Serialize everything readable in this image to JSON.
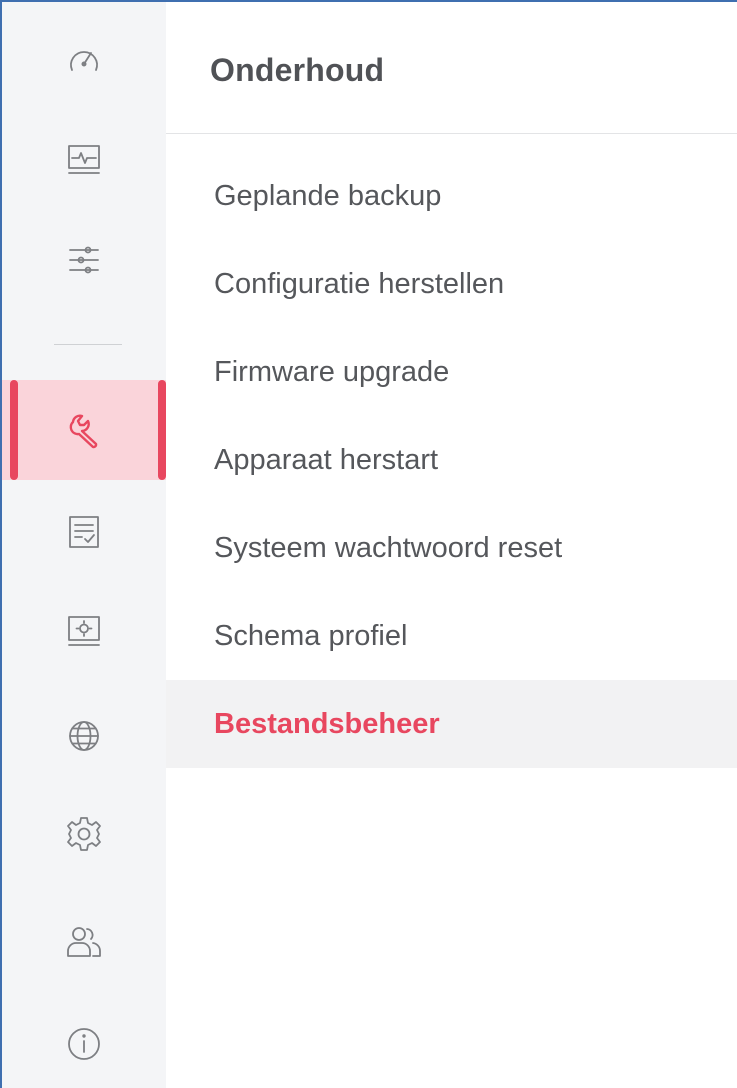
{
  "section": {
    "title": "Onderhoud"
  },
  "rail": {
    "items": [
      {
        "icon": "gauge-icon",
        "label": ""
      },
      {
        "icon": "activity-monitor-icon",
        "label": ""
      },
      {
        "icon": "sliders-icon",
        "label": ""
      },
      {
        "icon": "wrench-icon",
        "label": "",
        "active": true
      },
      {
        "icon": "checklist-icon",
        "label": ""
      },
      {
        "icon": "screen-settings-icon",
        "label": ""
      },
      {
        "icon": "globe-icon",
        "label": ""
      },
      {
        "icon": "gear-icon",
        "label": ""
      },
      {
        "icon": "users-icon",
        "label": ""
      },
      {
        "icon": "info-icon",
        "label": ""
      }
    ],
    "active_color": "#e8475f",
    "active_background": "#fad4da"
  },
  "menu": {
    "items": [
      {
        "label": "Geplande backup"
      },
      {
        "label": "Configuratie herstellen"
      },
      {
        "label": "Firmware upgrade"
      },
      {
        "label": "Apparaat herstart"
      },
      {
        "label": "Systeem wachtwoord reset"
      },
      {
        "label": "Schema profiel"
      },
      {
        "label": "Bestandsbeheer",
        "active": true
      }
    ],
    "active_color": "#e8475f"
  }
}
